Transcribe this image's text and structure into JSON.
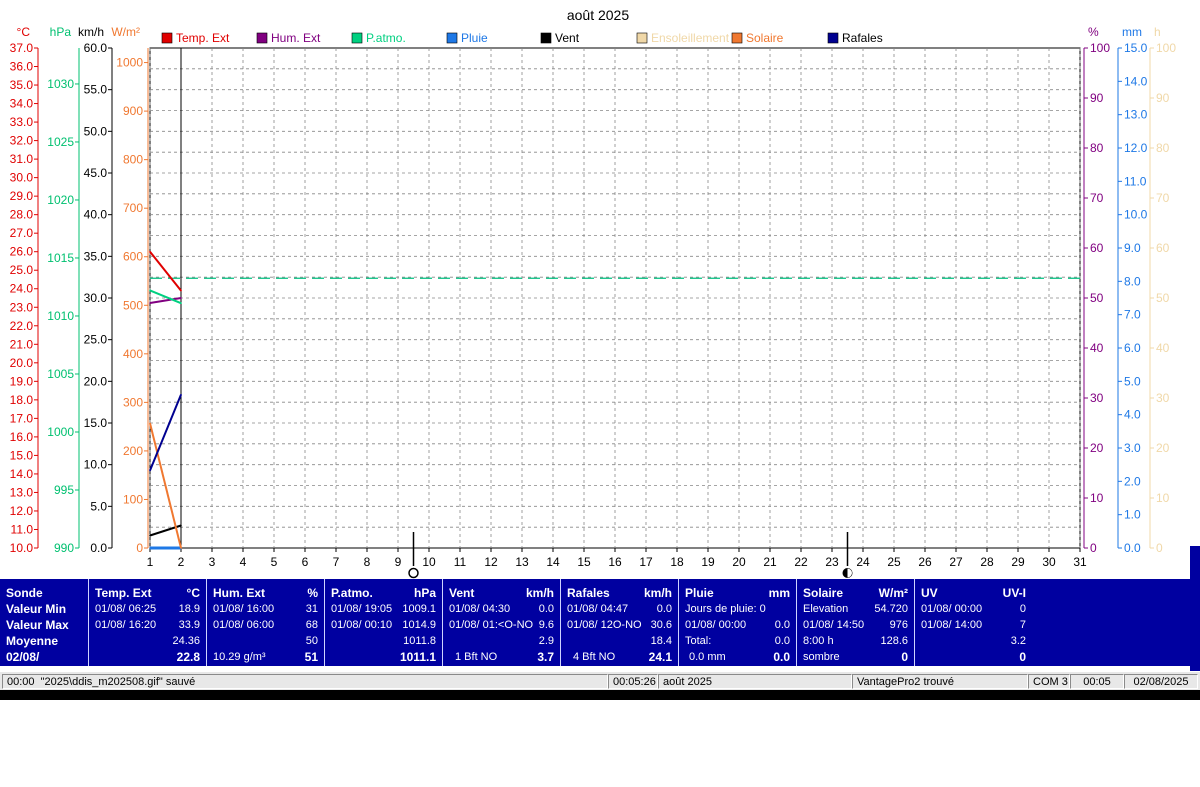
{
  "chart_data": {
    "type": "line",
    "title": "août 2025",
    "x": [
      1,
      2
    ],
    "xlim": [
      1,
      31
    ],
    "xticks": [
      1,
      2,
      3,
      4,
      5,
      6,
      7,
      8,
      9,
      10,
      11,
      12,
      13,
      14,
      15,
      16,
      17,
      18,
      19,
      20,
      21,
      22,
      23,
      24,
      25,
      26,
      27,
      28,
      29,
      30,
      31
    ],
    "grid": true,
    "legend": [
      {
        "name": "Temp. Ext",
        "color": "#e00000"
      },
      {
        "name": "Hum. Ext",
        "color": "#800080"
      },
      {
        "name": "P.atmo.",
        "color": "#00d080"
      },
      {
        "name": "Pluie",
        "color": "#1e78e6"
      },
      {
        "name": "Vent",
        "color": "#000000"
      },
      {
        "name": "Ensoleillement",
        "color": "#f0d8a8"
      },
      {
        "name": "Solaire",
        "color": "#f07830"
      },
      {
        "name": "Rafales",
        "color": "#000090"
      }
    ],
    "axes": [
      {
        "unit": "°C",
        "color": "#e00000",
        "ylim": [
          10,
          37
        ],
        "ticks": [
          "10.0",
          "11.0",
          "12.0",
          "13.0",
          "14.0",
          "15.0",
          "16.0",
          "17.0",
          "18.0",
          "19.0",
          "20.0",
          "21.0",
          "22.0",
          "23.0",
          "24.0",
          "25.0",
          "26.0",
          "27.0",
          "28.0",
          "29.0",
          "30.0",
          "31.0",
          "32.0",
          "33.0",
          "34.0",
          "35.0",
          "36.0",
          "37.0"
        ]
      },
      {
        "unit": "hPa",
        "color": "#00c070",
        "ylim": [
          990,
          1033.1
        ],
        "ticks": [
          "990",
          "995",
          "1000",
          "1005",
          "1010",
          "1015",
          "1020",
          "1025",
          "1030"
        ]
      },
      {
        "unit": "km/h",
        "color": "#000000",
        "ylim": [
          0,
          60
        ],
        "ticks": [
          "0.0",
          "5.0",
          "10.0",
          "15.0",
          "20.0",
          "25.0",
          "30.0",
          "35.0",
          "40.0",
          "45.0",
          "50.0",
          "55.0",
          "60.0"
        ]
      },
      {
        "unit": "W/m²",
        "color": "#f07830",
        "ylim": [
          0,
          1030
        ],
        "ticks": [
          "0",
          "100",
          "200",
          "300",
          "400",
          "500",
          "600",
          "700",
          "800",
          "900",
          "1000"
        ]
      },
      {
        "unit": "%",
        "color": "#800080",
        "ylim": [
          0,
          100
        ],
        "ticks": [
          "0",
          "10",
          "20",
          "30",
          "40",
          "50",
          "60",
          "70",
          "80",
          "90",
          "100"
        ]
      },
      {
        "unit": "mm",
        "color": "#1e78e6",
        "ylim": [
          0,
          15
        ],
        "ticks": [
          "0.0",
          "1.0",
          "2.0",
          "3.0",
          "4.0",
          "5.0",
          "6.0",
          "7.0",
          "8.0",
          "9.0",
          "10.0",
          "11.0",
          "12.0",
          "13.0",
          "14.0",
          "15.0"
        ]
      },
      {
        "unit": "h",
        "color": "#f0d8a8",
        "ylim": [
          0,
          100
        ],
        "ticks": [
          "0",
          "10",
          "20",
          "30",
          "40",
          "50",
          "60",
          "70",
          "80",
          "90",
          "100"
        ]
      }
    ],
    "series": [
      {
        "name": "Temp. Ext",
        "axis": 0,
        "color": "#e00000",
        "values": [
          26.0,
          23.9
        ]
      },
      {
        "name": "Hum. Ext",
        "axis": 4,
        "color": "#800080",
        "values": [
          49,
          50
        ]
      },
      {
        "name": "P.atmo.",
        "axis": 1,
        "color": "#00d080",
        "values": [
          1012.2,
          1011.1
        ]
      },
      {
        "name": "Pluie",
        "axis": 5,
        "color": "#1e78e6",
        "values": [
          0.0,
          0.0
        ]
      },
      {
        "name": "Vent",
        "axis": 2,
        "color": "#000000",
        "values": [
          1.5,
          2.7
        ]
      },
      {
        "name": "Solaire",
        "axis": 3,
        "color": "#f07830",
        "values": [
          257,
          0
        ]
      },
      {
        "name": "Rafales",
        "axis": 2,
        "color": "#000090",
        "values": [
          9.3,
          18.4
        ]
      }
    ],
    "reference_line": {
      "axis": 1,
      "value": 1013.25,
      "color": "#00c080",
      "style": "dashed"
    },
    "moon_markers": [
      {
        "day": 9.5,
        "phase": "new"
      },
      {
        "day": 23.5,
        "phase": "half"
      }
    ]
  },
  "panel": {
    "row_labels": [
      "Sonde",
      "Valeur Min",
      "Valeur Max",
      "Moyenne",
      "02/08/"
    ],
    "temp": {
      "title": "Temp. Ext",
      "unit": "°C",
      "min_time": "01/08/  06:25",
      "min": "18.9",
      "max_time": "01/08/  16:20",
      "max": "33.9",
      "avg": "24.36",
      "current": "22.8"
    },
    "hum": {
      "title": "Hum. Ext",
      "unit": "%",
      "min_time": "01/08/  16:00",
      "min": "31",
      "max_time": "01/08/  06:00",
      "max": "68",
      "avg": "50",
      "abs": "10.29 g/m³",
      "current": "51"
    },
    "press": {
      "title": "P.atmo.",
      "unit": "hPa",
      "min_time": "01/08/  19:05",
      "min": "1009.1",
      "max_time": "01/08/  00:10",
      "max": "1014.9",
      "avg": "1011.8",
      "current": "1011.1"
    },
    "wind": {
      "title": "Vent",
      "unit": "km/h",
      "min_time": "01/08/  04:30",
      "min": "0.0",
      "max_time": "01/08/  01:<O-NO",
      "max": "9.6",
      "avg": "2.9",
      "bft": "1 Bft NO",
      "current": "3.7"
    },
    "gust": {
      "title": "Rafales",
      "unit": "km/h",
      "min_time": "01/08/  04:47",
      "min": "0.0",
      "max_time": "01/08/  12O-NO",
      "max": "30.6",
      "avg": "18.4",
      "bft": "4 Bft NO",
      "current": "24.1"
    },
    "rain": {
      "title": "Pluie",
      "unit": "mm",
      "days": "Jours de pluie: 0",
      "max_time": "01/08/  00:00",
      "max": "0.0",
      "total_label": "Total:",
      "total": "0.0",
      "cur_label": "0.0 mm",
      "current": "0.0"
    },
    "solar": {
      "title": "Solaire",
      "unit": "W/m²",
      "elev_label": "Elevation",
      "elev": "54.720",
      "max_time": "01/08/  14:50",
      "max": "976",
      "sun_label": "8:00 h",
      "sun": "128.6",
      "state": "sombre",
      "current": "0"
    },
    "uv": {
      "title": "UV",
      "unit": "UV-I",
      "min_time": "01/08/  00:00",
      "min": "0",
      "max_time": "01/08/  14:00",
      "max": "7",
      "avg": "3.2",
      "current": "0"
    }
  },
  "status": {
    "time_msg": "00:00",
    "message": "\"2025\\ddis_m202508.gif\"  sauvé",
    "clock": "00:05:26",
    "month": "août 2025",
    "device": "VantagePro2 trouvé",
    "port": "COM 3",
    "time": "00:05",
    "date": "02/08/2025"
  }
}
